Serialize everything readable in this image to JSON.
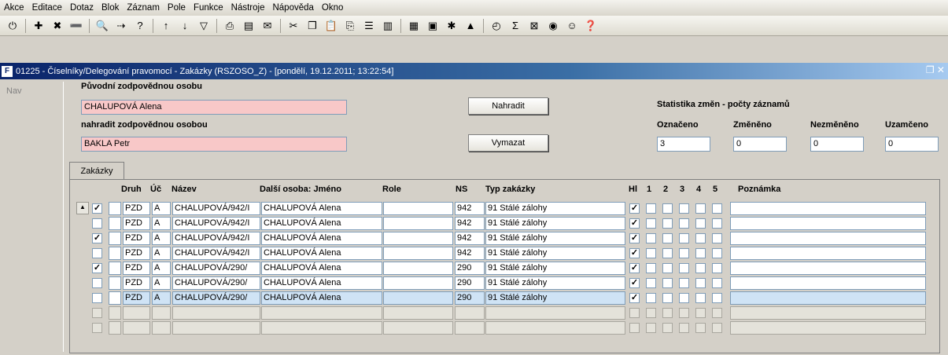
{
  "menu": [
    "Akce",
    "Editace",
    "Dotaz",
    "Blok",
    "Záznam",
    "Pole",
    "Funkce",
    "Nástroje",
    "Nápověda",
    "Okno"
  ],
  "toolbar": [
    {
      "icon": "exit-icon"
    },
    {
      "icon": "sep"
    },
    {
      "icon": "insert-record-icon"
    },
    {
      "icon": "delete-record-icon"
    },
    {
      "icon": "remove-icon"
    },
    {
      "icon": "sep"
    },
    {
      "icon": "find-icon"
    },
    {
      "icon": "find-next-icon"
    },
    {
      "icon": "query-icon"
    },
    {
      "icon": "sep"
    },
    {
      "icon": "sort-asc-icon"
    },
    {
      "icon": "sort-desc-icon"
    },
    {
      "icon": "filter-icon"
    },
    {
      "icon": "sep"
    },
    {
      "icon": "print-icon"
    },
    {
      "icon": "print-preview-icon"
    },
    {
      "icon": "mail-icon"
    },
    {
      "icon": "sep"
    },
    {
      "icon": "cut-icon"
    },
    {
      "icon": "copy-icon"
    },
    {
      "icon": "paste-icon"
    },
    {
      "icon": "attach-icon"
    },
    {
      "icon": "list-icon"
    },
    {
      "icon": "columns-icon"
    },
    {
      "icon": "sep"
    },
    {
      "icon": "chart-icon"
    },
    {
      "icon": "save-icon"
    },
    {
      "icon": "tools-icon"
    },
    {
      "icon": "warning-icon"
    },
    {
      "icon": "sep"
    },
    {
      "icon": "clock-icon"
    },
    {
      "icon": "sum-icon"
    },
    {
      "icon": "excel-icon"
    },
    {
      "icon": "web-icon"
    },
    {
      "icon": "help-people-icon"
    },
    {
      "icon": "help-icon"
    }
  ],
  "window": {
    "title": "01225 - Číselníky/Delegování pravomocí - Zakázky (RSZOSO_Z) - [pondělí, 19.12.2011; 13:22:54]"
  },
  "nav_label": "Nav",
  "form": {
    "original_label": "Původní zodpovědnou osobu",
    "original_value": "CHALUPOVÁ Alena",
    "replace_label": "nahradit zodpovědnou osobou",
    "replace_value": "BAKLA Petr",
    "replace_button": "Nahradit",
    "delete_button": "Vymazat"
  },
  "stats": {
    "title": "Statistika změn - počty záznamů",
    "labels": [
      "Označeno",
      "Změněno",
      "Nezměněno",
      "Uzamčeno"
    ],
    "values": [
      "3",
      "0",
      "0",
      "0"
    ]
  },
  "tab_label": "Zakázky",
  "table": {
    "headers": {
      "druh": "Druh",
      "uc": "Úč",
      "nazev": "Název",
      "dalsi": "Další osoba: Jméno",
      "role": "Role",
      "ns": "NS",
      "typ": "Typ zakázky",
      "hl": "Hl",
      "c1": "1",
      "c2": "2",
      "c3": "3",
      "c4": "4",
      "c5": "5",
      "pozn": "Poznámka"
    },
    "rows": [
      {
        "checked": true,
        "druh": "PZD",
        "uc": "A",
        "nazev": "CHALUPOVÁ/942/I",
        "dalsi": "CHALUPOVÁ Alena",
        "role": "",
        "ns": "942",
        "typ": "91 Stálé zálohy",
        "hl": true
      },
      {
        "checked": false,
        "druh": "PZD",
        "uc": "A",
        "nazev": "CHALUPOVÁ/942/I",
        "dalsi": "CHALUPOVÁ Alena",
        "role": "",
        "ns": "942",
        "typ": "91 Stálé zálohy",
        "hl": true
      },
      {
        "checked": true,
        "druh": "PZD",
        "uc": "A",
        "nazev": "CHALUPOVÁ/942/I",
        "dalsi": "CHALUPOVÁ Alena",
        "role": "",
        "ns": "942",
        "typ": "91 Stálé zálohy",
        "hl": true
      },
      {
        "checked": false,
        "druh": "PZD",
        "uc": "A",
        "nazev": "CHALUPOVÁ/942/I",
        "dalsi": "CHALUPOVÁ Alena",
        "role": "",
        "ns": "942",
        "typ": "91 Stálé zálohy",
        "hl": true
      },
      {
        "checked": true,
        "druh": "PZD",
        "uc": "A",
        "nazev": "CHALUPOVÁ/290/",
        "dalsi": "CHALUPOVÁ Alena",
        "role": "",
        "ns": "290",
        "typ": "91 Stálé zálohy",
        "hl": true
      },
      {
        "checked": false,
        "druh": "PZD",
        "uc": "A",
        "nazev": "CHALUPOVÁ/290/",
        "dalsi": "CHALUPOVÁ Alena",
        "role": "",
        "ns": "290",
        "typ": "91 Stálé zálohy",
        "hl": true
      },
      {
        "checked": false,
        "druh": "PZD",
        "uc": "A",
        "nazev": "CHALUPOVÁ/290/",
        "dalsi": "CHALUPOVÁ Alena",
        "role": "",
        "ns": "290",
        "typ": "91 Stálé zálohy",
        "hl": true,
        "selected": true
      },
      {
        "empty": true
      },
      {
        "empty": true
      }
    ]
  }
}
